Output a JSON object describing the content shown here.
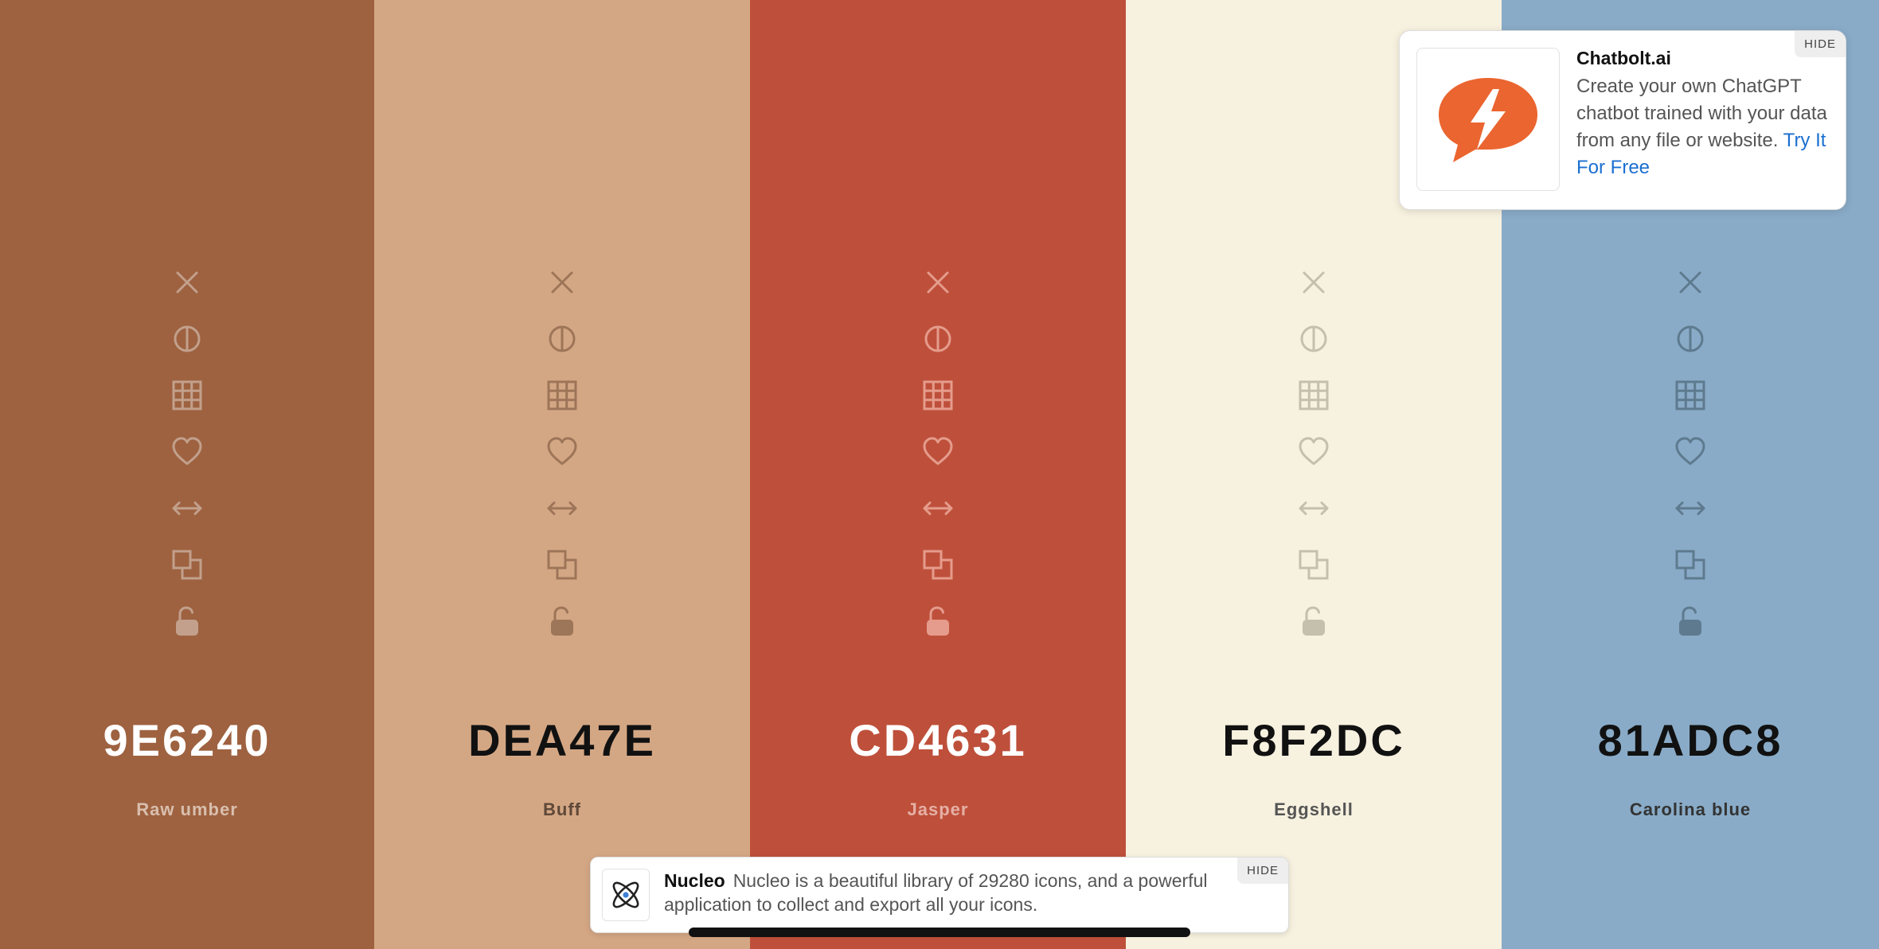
{
  "palette": {
    "colors": [
      {
        "hex": "9E6240",
        "name": "Raw umber",
        "bg": "#9E6240",
        "text_color": "#ffffff",
        "name_color": "#d9bfae",
        "icon_color": "#c2a08c"
      },
      {
        "hex": "DEA47E",
        "name": "Buff",
        "bg": "#D4A784",
        "text_color": "#111111",
        "name_color": "#5e4838",
        "icon_color": "#9d7558"
      },
      {
        "hex": "CD4631",
        "name": "Jasper",
        "bg": "#BE503B",
        "text_color": "#ffffff",
        "name_color": "#e5b0a5",
        "icon_color": "#e59c8c"
      },
      {
        "hex": "F8F2DC",
        "name": "Eggshell",
        "bg": "#F7F1DF",
        "text_color": "#111111",
        "name_color": "#555555",
        "icon_color": "#c5c0ae"
      },
      {
        "hex": "81ADC8",
        "name": "Carolina blue",
        "bg": "#89ABC7",
        "text_color": "#111111",
        "name_color": "#333333",
        "icon_color": "#5e7a8f"
      }
    ],
    "tool_icons": [
      "remove-icon",
      "contrast-icon",
      "shades-grid-icon",
      "favorite-heart-icon",
      "drag-arrows-icon",
      "copy-icon",
      "lock-icon"
    ]
  },
  "ad_chatbolt": {
    "title": "Chatbolt.ai",
    "body": "Create your own ChatGPT chatbot trained with your data from any file or website.",
    "cta": "Try It For Free",
    "hide": "HIDE",
    "brand_color": "#EB6530",
    "icon": "chatbolt-logo-icon"
  },
  "ad_nucleo": {
    "title": "Nucleo",
    "body": "Nucleo is a beautiful library of 29280 icons, and a powerful application to collect and export all your icons.",
    "hide": "HIDE",
    "icon": "nucleo-atom-logo-icon"
  }
}
